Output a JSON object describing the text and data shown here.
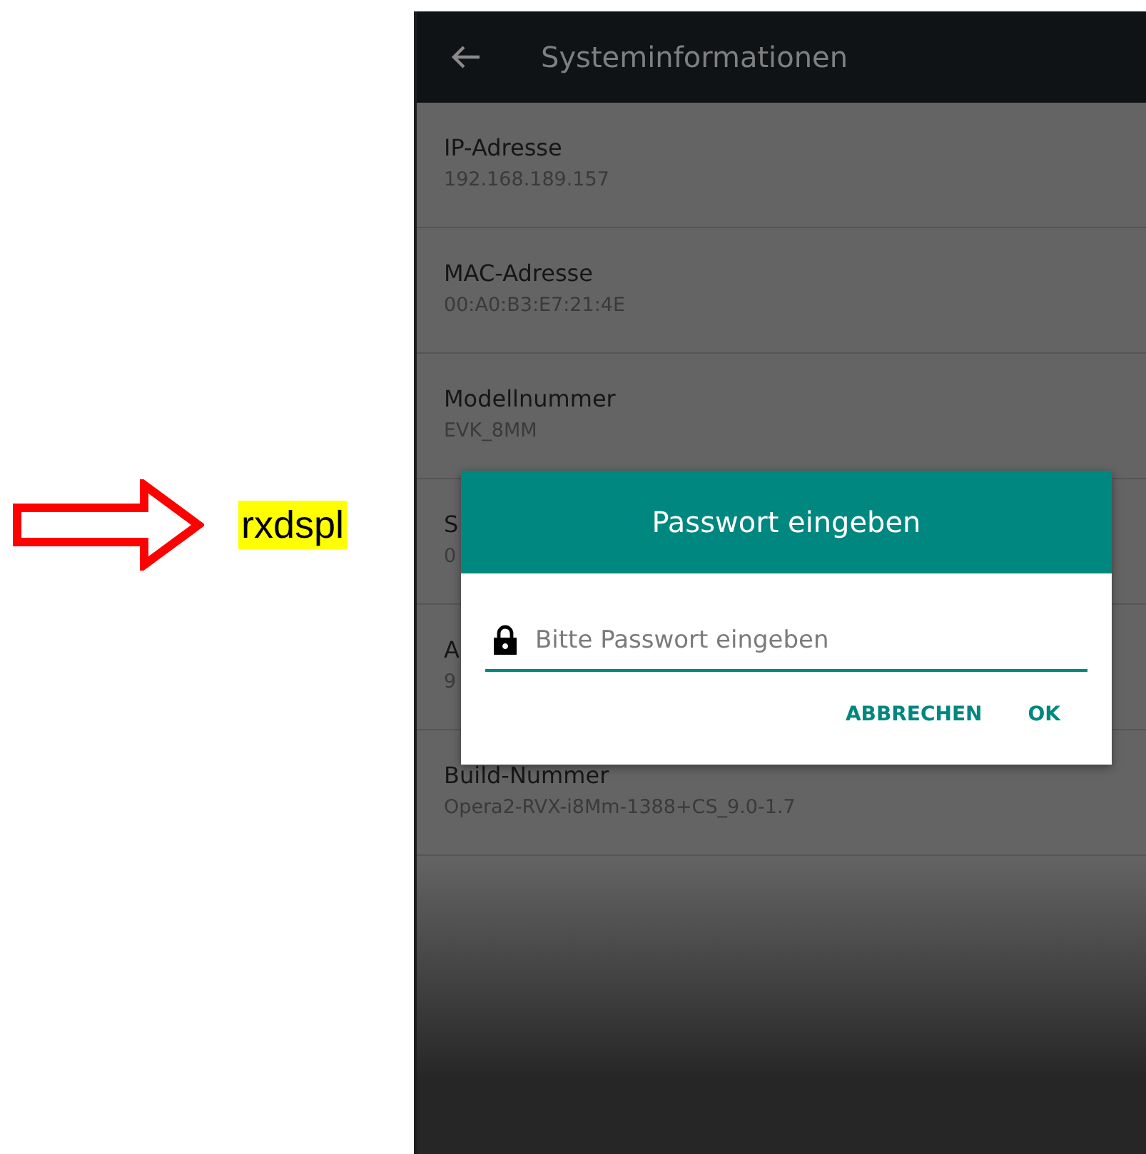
{
  "annotation": {
    "label": "rxdspl"
  },
  "app_bar": {
    "title": "Systeminformationen"
  },
  "items": [
    {
      "title": "IP-Adresse",
      "value": "192.168.189.157"
    },
    {
      "title": "MAC-Adresse",
      "value": "00:A0:B3:E7:21:4E"
    },
    {
      "title": "Modellnummer",
      "value": "EVK_8MM"
    },
    {
      "title": "S",
      "value": "0"
    },
    {
      "title": "A",
      "value": "9"
    },
    {
      "title": "Build-Nummer",
      "value": "Opera2-RVX-i8Mm-1388+CS_9.0-1.7"
    }
  ],
  "dialog": {
    "title": "Passwort eingeben",
    "field": {
      "placeholder": "Bitte Passwort eingeben"
    },
    "buttons": [
      "ABBRECHEN",
      "OK"
    ]
  }
}
